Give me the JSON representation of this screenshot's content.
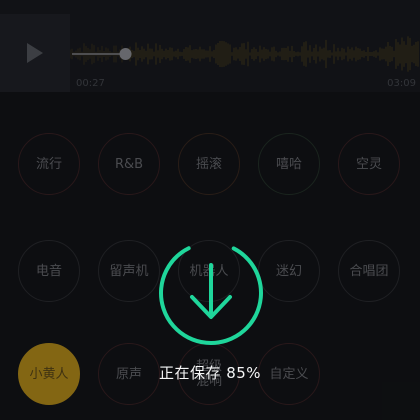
{
  "player": {
    "current_time": "00:27",
    "total_time": "03:09",
    "progress": 0.15
  },
  "effects": {
    "row1": [
      "流行",
      "R&B",
      "摇滚",
      "嘻哈",
      "空灵"
    ],
    "row2": [
      "电音",
      "留声机",
      "机器人",
      "迷幻",
      "合唱团"
    ],
    "row3": [
      "小黄人",
      "原声",
      "超级\n混响",
      "自定义"
    ],
    "selected": "小黄人"
  },
  "saving": {
    "label": "正在保存 85%",
    "percent": 85
  },
  "colors": {
    "accent": "#1fd69b",
    "waveform": "#c79a1a",
    "selected": "#c79a1a"
  }
}
